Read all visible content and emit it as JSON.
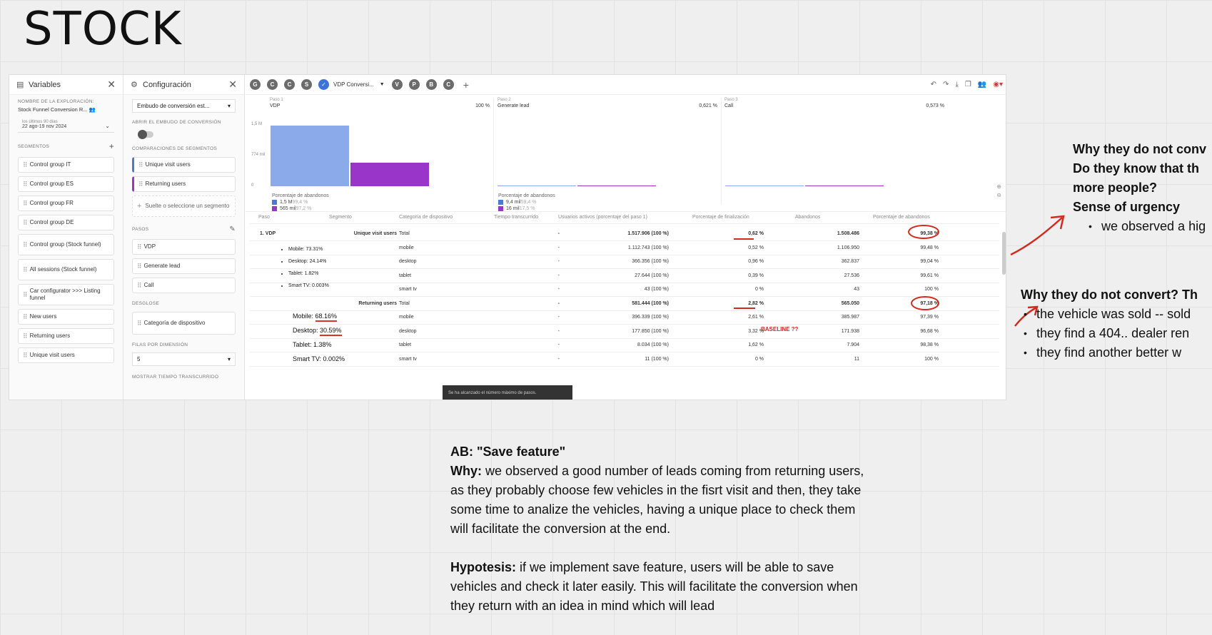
{
  "board": {
    "title": "STOCK"
  },
  "variables": {
    "title": "Variables",
    "exploration_label": "NOMBRE DE LA EXPLORACIÓN:",
    "exploration_name": "Stock Funnel Conversion R...",
    "date_label": "los últimos 90 días",
    "date_range": "22 ago-19 nov 2024",
    "segments_label": "SEGMENTOS",
    "segments": [
      "Control group IT",
      "Control group ES",
      "Control group FR",
      "Control group DE",
      "Control group (Stock funnel)",
      "All sessions (Stock funnel)",
      "Car configurator >>> Listing funnel",
      "New users",
      "Returning users",
      "Unique visit users"
    ]
  },
  "config": {
    "title": "Configuración",
    "technique": "Embudo de conversión est...",
    "open_funnel_label": "ABRIR EL EMBUDO DE CONVERSIÓN",
    "comparisons_label": "COMPARACIONES DE SEGMENTOS",
    "comparisons": [
      "Unique visit users",
      "Returning users"
    ],
    "drop_segment": "Suelte o seleccione un segmento",
    "steps_label": "PASOS",
    "steps": [
      "VDP",
      "Generate lead",
      "Call"
    ],
    "breakdown_label": "DESGLOSE",
    "breakdown": "Categoría de dispositivo",
    "rows_label": "FILAS POR DIMENSIÓN",
    "rows_value": "5",
    "elapsed_label": "MOSTRAR TIEMPO TRANSCURRIDO"
  },
  "tabs": {
    "circles": [
      "G",
      "C",
      "C",
      "S"
    ],
    "active": "VDP Conversi...",
    "after": [
      "V",
      "P",
      "B",
      "C"
    ],
    "plus": "+"
  },
  "funnel": {
    "steps": [
      {
        "num": "Paso 1",
        "name": "VDP",
        "pct": "100 %"
      },
      {
        "num": "Paso 2",
        "name": "Generate lead",
        "pct": "0,621 %"
      },
      {
        "num": "Paso 3",
        "name": "Call",
        "pct": "0,573 %"
      }
    ],
    "y_ticks": [
      "1,5 M",
      "774 mil",
      "0"
    ],
    "abandon_label": "Porcentaje de abandonos",
    "abandon_step1": [
      {
        "value": "1,5 M",
        "pct": "99,4 %"
      },
      {
        "value": "565 mil",
        "pct": "97,2 %"
      }
    ],
    "abandon_step2": [
      {
        "value": "9,4 mil",
        "pct": "59,4 %"
      },
      {
        "value": "16 mil",
        "pct": "17,5 %"
      }
    ],
    "colors": {
      "unique": "#8aaae9",
      "returning": "#9a35c9"
    }
  },
  "chart_data": {
    "type": "bar",
    "categories": [
      "VDP",
      "Generate lead",
      "Call"
    ],
    "series": [
      {
        "name": "Unique visit users",
        "values": [
          1517906,
          9420,
          8700
        ]
      },
      {
        "name": "Returning users",
        "values": [
          581444,
          16400,
          15400
        ]
      }
    ],
    "ylim": [
      0,
      1550000
    ]
  },
  "table": {
    "headers": [
      "Paso",
      "Segmento",
      "Categoría de dispositivo",
      "Tiempo transcurrido",
      "Usuarios activos (porcentaje del paso 1)",
      "Porcentaje de finalización",
      "Abandonos",
      "Porcentaje de abandonos"
    ],
    "step": "1. VDP",
    "rows": [
      {
        "segment": "Unique visit users",
        "device": "Total",
        "time": "-",
        "users": "1.517.906 (100 %)",
        "completion": "0,62 %",
        "abandons": "1.508.486",
        "abandon_pct": "99,38 %",
        "bold": true
      },
      {
        "segment": "",
        "device": "mobile",
        "time": "-",
        "users": "1.112.743 (100 %)",
        "completion": "0,52 %",
        "abandons": "1.106.950",
        "abandon_pct": "99,48 %"
      },
      {
        "segment": "",
        "device": "desktop",
        "time": "-",
        "users": "366.356 (100 %)",
        "completion": "0,96 %",
        "abandons": "362.837",
        "abandon_pct": "99,04 %"
      },
      {
        "segment": "",
        "device": "tablet",
        "time": "-",
        "users": "27.644 (100 %)",
        "completion": "0,39 %",
        "abandons": "27.536",
        "abandon_pct": "99,61 %"
      },
      {
        "segment": "",
        "device": "smart tv",
        "time": "-",
        "users": "43 (100 %)",
        "completion": "0 %",
        "abandons": "43",
        "abandon_pct": "100 %"
      },
      {
        "segment": "Returning users",
        "device": "Total",
        "time": "-",
        "users": "581.444 (100 %)",
        "completion": "2,82 %",
        "abandons": "565.050",
        "abandon_pct": "97,18 %",
        "bold": true
      },
      {
        "segment": "",
        "device": "mobile",
        "time": "-",
        "users": "396.339 (100 %)",
        "completion": "2,61 %",
        "abandons": "385.987",
        "abandon_pct": "97,39 %"
      },
      {
        "segment": "",
        "device": "desktop",
        "time": "-",
        "users": "177.850 (100 %)",
        "completion": "3,32 %",
        "abandons": "171.938",
        "abandon_pct": "96,68 %"
      },
      {
        "segment": "",
        "device": "tablet",
        "time": "-",
        "users": "8.034 (100 %)",
        "completion": "1,62 %",
        "abandons": "7.904",
        "abandon_pct": "98,38 %"
      },
      {
        "segment": "",
        "device": "smart tv",
        "time": "-",
        "users": "11 (100 %)",
        "completion": "0 %",
        "abandons": "11",
        "abandon_pct": "100 %"
      }
    ],
    "unique_breakdown": [
      "Mobile: 73.31%",
      "Desktop: 24.14%",
      "Tablet: 1.82%",
      "Smart TV: 0.003%"
    ],
    "returning_breakdown": {
      "mobile_label": "Mobile: ",
      "mobile_val": "68.16%",
      "desktop_label": "Desktop: ",
      "desktop_val": "30.59%",
      "tablet": "Tablet: 1.38%",
      "smarttv": "Smart TV: 0.002%"
    },
    "baseline": "BASELINE ??",
    "toast": "Se ha alcanzado el número máximo de pasos."
  },
  "notes": {
    "urgency": {
      "line1": "Why they do not conv",
      "line2": "Do they know that th",
      "line3": "more people?",
      "line4": "Sense of urgency",
      "bullet": "we observed a hig"
    },
    "convert": {
      "title": "Why they do not convert? Th",
      "bullets": [
        "the vehicle was sold -- sold",
        "they find a 404.. dealer ren",
        "they find another better w"
      ]
    },
    "ab": {
      "title": "AB: \"Save feature\"",
      "why_label": "Why:",
      "why_text": " we observed a good number of leads coming from returning users, as they probably choose few vehicles in the fisrt visit  and then, they take some time to analize the vehicles, having a unique place to check them will facilitate the conversion at the end.",
      "hyp_label": "Hypotesis:",
      "hyp_text": " if we implement save feature, users will be able to save vehicles and check it later easily. This will facilitate the conversion when they return with an idea in mind which will lead"
    }
  }
}
